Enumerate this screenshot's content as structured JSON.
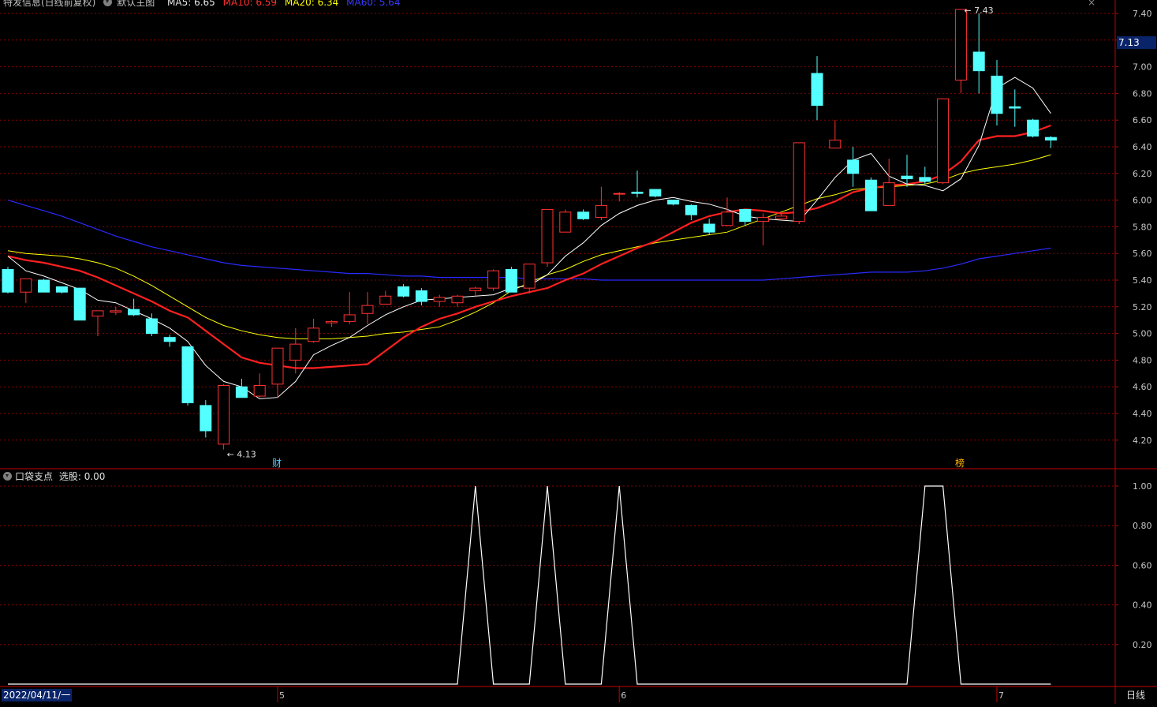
{
  "header": {
    "stock_name": "特发信息(日线前复权)",
    "indicator_name": "默认主图",
    "ma5": "MA5: 6.65",
    "ma10": "MA10: 6.59",
    "ma20": "MA20: 6.34",
    "ma60": "MA60: 5.64",
    "close_label": "×"
  },
  "sub_header": {
    "label": "口袋支点",
    "value_text": "选股: 0.00"
  },
  "current_price_tag": "7.13",
  "date_label": "2022/04/11/一",
  "period_label": "日线",
  "markers": {
    "cai": "财",
    "bang": "榜"
  },
  "colors": {
    "bg": "#000000",
    "up": "#ff3232",
    "down": "#54ffff",
    "grid": "#8b0000",
    "ma5": "#ffffff",
    "ma10": "#ff2020",
    "ma20": "#ffff00",
    "ma60": "#2a2aff",
    "axis": "#c80000",
    "text": "#c0c0c0"
  },
  "chart_data": [
    {
      "type": "candlestick",
      "ylim": [
        4.05,
        7.48
      ],
      "yticks": [
        4.2,
        4.4,
        4.6,
        4.8,
        5.0,
        5.2,
        5.4,
        5.6,
        5.8,
        6.0,
        6.2,
        6.4,
        6.6,
        6.8,
        7.0,
        7.2,
        7.4
      ],
      "x_month_labels": [
        {
          "label": "5",
          "index": 15
        },
        {
          "label": "6",
          "index": 34
        },
        {
          "label": "7",
          "index": 55
        }
      ],
      "annotations": [
        {
          "text": "7.43",
          "index": 53
        },
        {
          "text": "4.13",
          "index": 12
        }
      ],
      "ohlc": [
        [
          5.48,
          5.5,
          5.3,
          5.31
        ],
        [
          5.31,
          5.41,
          5.23,
          5.41
        ],
        [
          5.4,
          5.41,
          5.31,
          5.31
        ],
        [
          5.35,
          5.35,
          5.3,
          5.31
        ],
        [
          5.34,
          5.34,
          5.1,
          5.1
        ],
        [
          5.13,
          5.17,
          4.98,
          5.17
        ],
        [
          5.16,
          5.2,
          5.14,
          5.17
        ],
        [
          5.18,
          5.26,
          5.13,
          5.14
        ],
        [
          5.11,
          5.15,
          4.98,
          5.0
        ],
        [
          4.97,
          4.99,
          4.9,
          4.94
        ],
        [
          4.9,
          4.9,
          4.46,
          4.48
        ],
        [
          4.46,
          4.5,
          4.22,
          4.27
        ],
        [
          4.17,
          4.62,
          4.13,
          4.61
        ],
        [
          4.6,
          4.66,
          4.52,
          4.52
        ],
        [
          4.53,
          4.7,
          4.52,
          4.61
        ],
        [
          4.62,
          4.89,
          4.52,
          4.89
        ],
        [
          4.8,
          5.04,
          4.7,
          4.92
        ],
        [
          4.94,
          5.11,
          4.93,
          5.04
        ],
        [
          5.08,
          5.1,
          5.05,
          5.09
        ],
        [
          5.09,
          5.31,
          5.07,
          5.14
        ],
        [
          5.15,
          5.31,
          5.07,
          5.21
        ],
        [
          5.22,
          5.32,
          5.22,
          5.28
        ],
        [
          5.35,
          5.37,
          5.27,
          5.28
        ],
        [
          5.32,
          5.34,
          5.21,
          5.24
        ],
        [
          5.24,
          5.29,
          5.2,
          5.27
        ],
        [
          5.23,
          5.29,
          5.2,
          5.28
        ],
        [
          5.32,
          5.35,
          5.27,
          5.34
        ],
        [
          5.34,
          5.48,
          5.32,
          5.47
        ],
        [
          5.48,
          5.5,
          5.31,
          5.31
        ],
        [
          5.34,
          5.52,
          5.3,
          5.52
        ],
        [
          5.53,
          5.93,
          5.5,
          5.93
        ],
        [
          5.76,
          5.93,
          5.76,
          5.91
        ],
        [
          5.91,
          5.93,
          5.85,
          5.86
        ],
        [
          5.87,
          6.1,
          5.85,
          5.96
        ],
        [
          6.05,
          6.06,
          5.99,
          6.05
        ],
        [
          6.06,
          6.22,
          6.02,
          6.05
        ],
        [
          6.08,
          6.08,
          6.02,
          6.03
        ],
        [
          6.0,
          6.0,
          5.96,
          5.97
        ],
        [
          5.96,
          5.97,
          5.85,
          5.89
        ],
        [
          5.82,
          5.86,
          5.74,
          5.76
        ],
        [
          5.81,
          6.02,
          5.81,
          5.91
        ],
        [
          5.93,
          5.93,
          5.81,
          5.84
        ],
        [
          5.84,
          5.9,
          5.66,
          5.87
        ],
        [
          5.86,
          5.91,
          5.85,
          5.88
        ],
        [
          5.84,
          6.43,
          5.82,
          6.43
        ],
        [
          6.95,
          7.08,
          6.6,
          6.71
        ],
        [
          6.39,
          6.6,
          6.39,
          6.45
        ],
        [
          6.3,
          6.4,
          6.1,
          6.2
        ],
        [
          6.15,
          6.17,
          5.92,
          5.92
        ],
        [
          5.96,
          6.31,
          5.96,
          6.13
        ],
        [
          6.18,
          6.34,
          6.1,
          6.16
        ],
        [
          6.17,
          6.25,
          6.12,
          6.14
        ],
        [
          6.13,
          6.76,
          6.12,
          6.76
        ],
        [
          6.9,
          7.43,
          6.8,
          7.43
        ],
        [
          7.11,
          7.4,
          6.8,
          6.97
        ],
        [
          6.93,
          7.05,
          6.56,
          6.65
        ],
        [
          6.7,
          6.83,
          6.55,
          6.69
        ],
        [
          6.6,
          6.61,
          6.47,
          6.48
        ],
        [
          6.47,
          6.48,
          6.39,
          6.45
        ]
      ],
      "series": [
        {
          "name": "MA5",
          "values": [
            5.58,
            5.47,
            5.43,
            5.38,
            5.33,
            5.25,
            5.23,
            5.17,
            5.11,
            5.04,
            4.94,
            4.76,
            4.64,
            4.6,
            4.51,
            4.52,
            4.64,
            4.84,
            4.91,
            4.97,
            5.06,
            5.14,
            5.2,
            5.25,
            5.26,
            5.27,
            5.28,
            5.29,
            5.34,
            5.36,
            5.44,
            5.58,
            5.68,
            5.81,
            5.9,
            5.96,
            6.0,
            6.02,
            5.99,
            5.97,
            5.93,
            5.88,
            5.86,
            5.85,
            5.84,
            6.0,
            6.17,
            6.3,
            6.35,
            6.18,
            6.12,
            6.11,
            6.07,
            6.16,
            6.41,
            6.84,
            6.92,
            6.84,
            6.65
          ]
        },
        {
          "name": "MA10",
          "values": [
            5.58,
            5.55,
            5.53,
            5.5,
            5.47,
            5.42,
            5.36,
            5.3,
            5.24,
            5.17,
            5.12,
            5.02,
            4.92,
            4.82,
            4.78,
            4.76,
            4.74,
            4.74,
            4.75,
            4.76,
            4.77,
            4.87,
            4.97,
            5.05,
            5.11,
            5.15,
            5.2,
            5.24,
            5.28,
            5.31,
            5.34,
            5.4,
            5.45,
            5.52,
            5.58,
            5.64,
            5.69,
            5.76,
            5.83,
            5.88,
            5.91,
            5.93,
            5.92,
            5.9,
            5.91,
            5.94,
            5.99,
            6.06,
            6.09,
            6.11,
            6.12,
            6.14,
            6.19,
            6.29,
            6.45,
            6.48,
            6.48,
            6.51,
            6.56
          ]
        },
        {
          "name": "MA20",
          "values": [
            5.62,
            5.6,
            5.59,
            5.58,
            5.56,
            5.53,
            5.49,
            5.43,
            5.36,
            5.28,
            5.2,
            5.12,
            5.06,
            5.02,
            4.99,
            4.97,
            4.96,
            4.96,
            4.96,
            4.97,
            4.98,
            5.0,
            5.01,
            5.03,
            5.05,
            5.1,
            5.16,
            5.23,
            5.32,
            5.38,
            5.44,
            5.48,
            5.54,
            5.59,
            5.62,
            5.65,
            5.68,
            5.7,
            5.72,
            5.74,
            5.76,
            5.81,
            5.86,
            5.91,
            5.96,
            6.01,
            6.04,
            6.08,
            6.09,
            6.1,
            6.11,
            6.12,
            6.15,
            6.2,
            6.23,
            6.25,
            6.27,
            6.3,
            6.34
          ]
        },
        {
          "name": "MA60",
          "values": [
            6.0,
            5.96,
            5.92,
            5.88,
            5.83,
            5.78,
            5.73,
            5.69,
            5.65,
            5.62,
            5.59,
            5.56,
            5.53,
            5.51,
            5.5,
            5.49,
            5.48,
            5.47,
            5.46,
            5.45,
            5.45,
            5.44,
            5.43,
            5.43,
            5.42,
            5.42,
            5.42,
            5.42,
            5.42,
            5.41,
            5.41,
            5.41,
            5.41,
            5.4,
            5.4,
            5.4,
            5.4,
            5.4,
            5.4,
            5.4,
            5.4,
            5.4,
            5.4,
            5.41,
            5.42,
            5.43,
            5.44,
            5.45,
            5.46,
            5.46,
            5.46,
            5.47,
            5.49,
            5.52,
            5.56,
            5.58,
            5.6,
            5.62,
            5.64
          ]
        }
      ]
    },
    {
      "type": "line",
      "title": "口袋支点",
      "ylim": [
        0,
        1.1
      ],
      "yticks": [
        0.2,
        0.4,
        0.6,
        0.8,
        1.0
      ],
      "series": [
        {
          "values": [
            0,
            0,
            0,
            0,
            0,
            0,
            0,
            0,
            0,
            0,
            0,
            0,
            0,
            0,
            0,
            0,
            0,
            0,
            0,
            0,
            0,
            0,
            0,
            0,
            0,
            0,
            1,
            0,
            0,
            0,
            1,
            0,
            0,
            0,
            1,
            0,
            0,
            0,
            0,
            0,
            0,
            0,
            0,
            0,
            0,
            0,
            0,
            0,
            0,
            0,
            0,
            1,
            1,
            0,
            0,
            0,
            0,
            0,
            0
          ]
        }
      ]
    }
  ]
}
